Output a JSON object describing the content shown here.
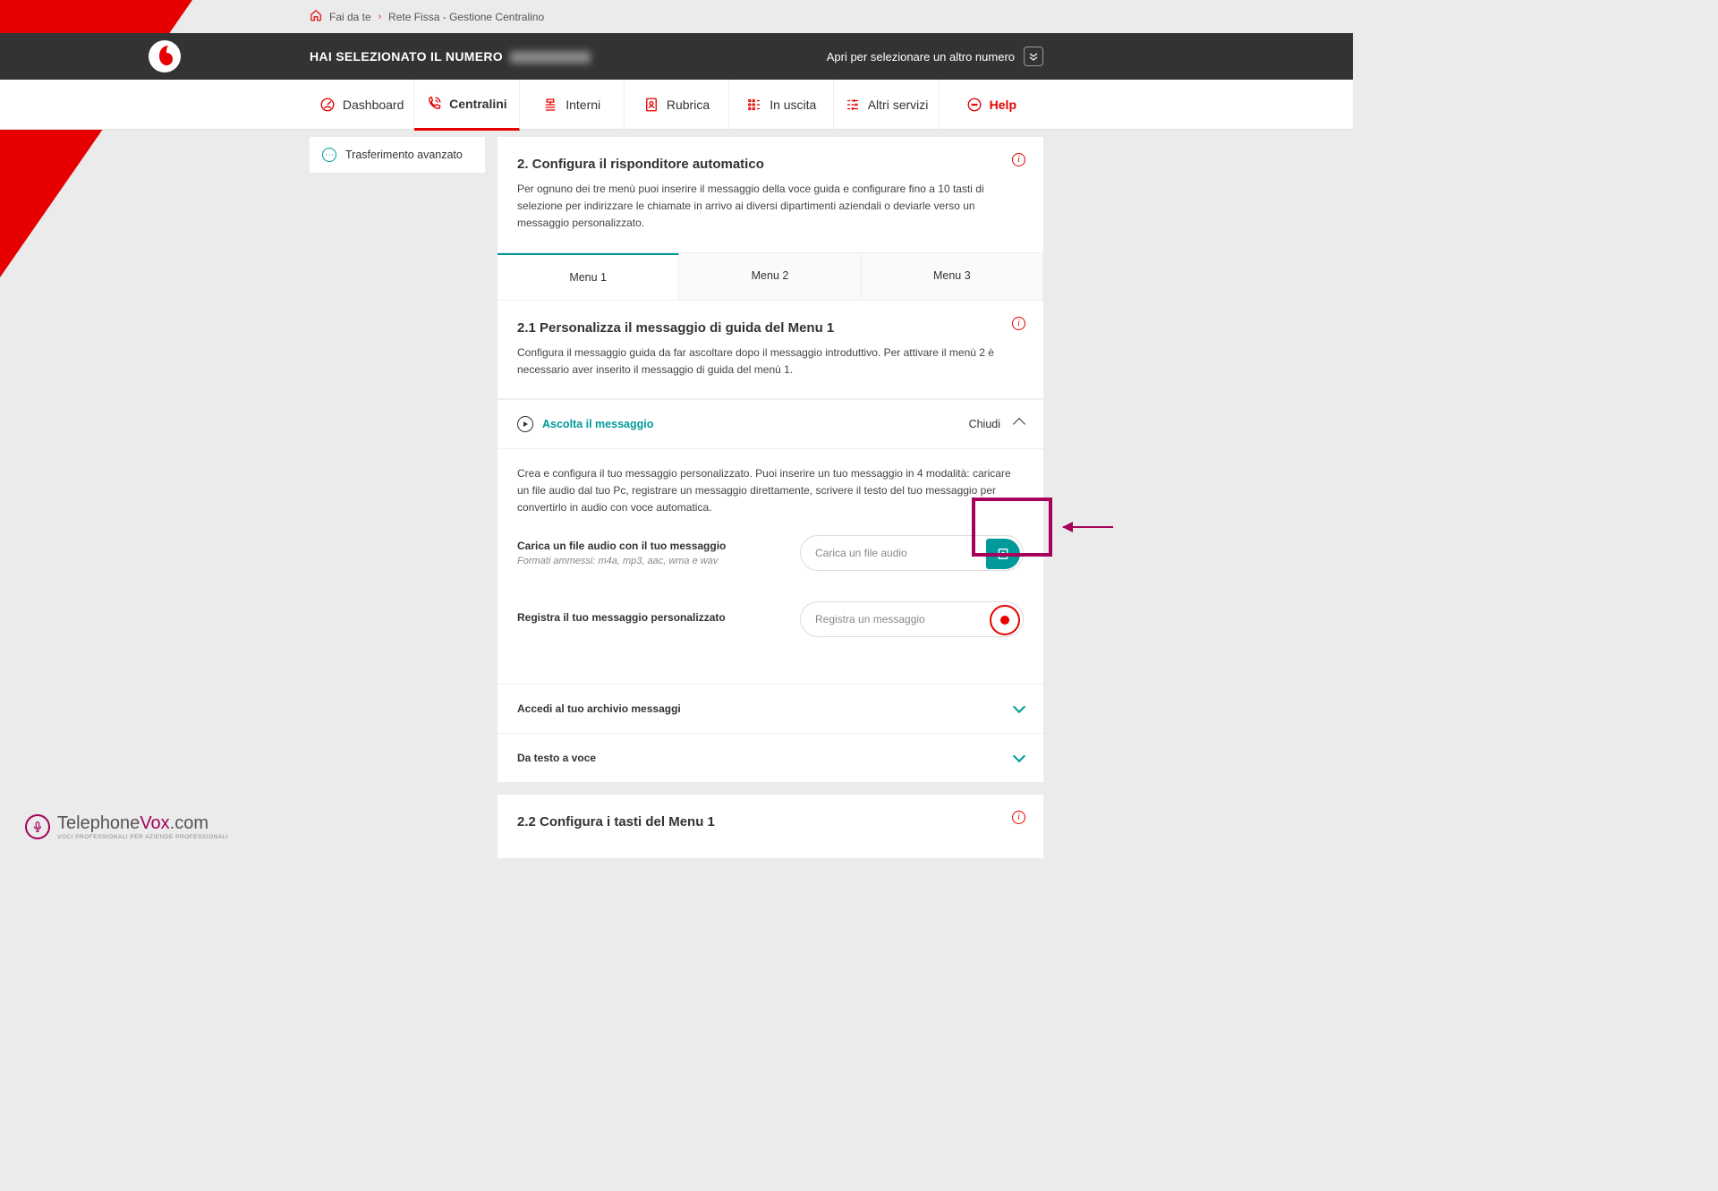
{
  "breadcrumb": {
    "home_label": "Fai da te",
    "current": "Rete Fissa - Gestione Centralino"
  },
  "selector_bar": {
    "prefix": "HAI SELEZIONATO IL NUMERO",
    "other_label": "Apri per selezionare un altro numero"
  },
  "nav": [
    {
      "label": "Dashboard"
    },
    {
      "label": "Centralini",
      "active": true
    },
    {
      "label": "Interni"
    },
    {
      "label": "Rubrica"
    },
    {
      "label": "In uscita"
    },
    {
      "label": "Altri servizi"
    },
    {
      "label": "Help",
      "help": true
    }
  ],
  "sidebar": {
    "item1": "Trasferimento avanzato"
  },
  "section2": {
    "title": "2. Configura il risponditore automatico",
    "desc": "Per ognuno dei tre menù puoi inserire il messaggio della voce guida e configurare fino a 10 tasti di selezione per indirizzare le chiamate in arrivo ai diversi dipartimenti aziendali o deviarle verso un messaggio personalizzato."
  },
  "subtabs": {
    "t1": "Menu 1",
    "t2": "Menu 2",
    "t3": "Menu 3"
  },
  "section21": {
    "title": "2.1 Personalizza il messaggio di guida del Menu 1",
    "desc": "Configura il messaggio guida da far ascoltare dopo il messaggio introduttivo. Per attivare il menù 2 è necessario aver inserito il messaggio di guida del menù 1."
  },
  "listen": {
    "label": "Ascolta il messaggio",
    "close": "Chiudi"
  },
  "config": {
    "intro": "Crea e configura il tuo messaggio personalizzato. Puoi inserire un tuo messaggio in 4 modalità: caricare un file audio dal tuo Pc, registrare un messaggio direttamente, scrivere il testo del tuo messaggio per convertirlo in audio con voce automatica.",
    "upload_title": "Carica un file audio con il tuo messaggio",
    "upload_hint": "Formati ammessi: m4a, mp3, aac, wma e wav",
    "upload_placeholder": "Carica un file audio",
    "record_title": "Registra il tuo messaggio personalizzato",
    "record_placeholder": "Registra un messaggio"
  },
  "collapse": {
    "archive": "Accedi al tuo archivio messaggi",
    "tts": "Da testo a voce"
  },
  "section22": {
    "title": "2.2 Configura i tasti del Menu 1"
  },
  "footer": {
    "brand1": "Telephone",
    "brand2": "Vox",
    "brand3": ".com",
    "tag": "Voci professionali per aziende professionali"
  }
}
